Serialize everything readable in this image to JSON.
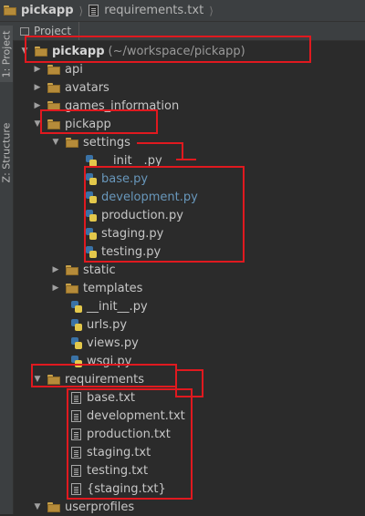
{
  "breadcrumb": {
    "root": "pickapp",
    "file": "requirements.txt"
  },
  "sidebar": {
    "project_tab": "1: Project",
    "structure_tab": "Z: Structure"
  },
  "panel": {
    "tab_label": "Project"
  },
  "tree": {
    "root": {
      "name": "pickapp",
      "path": "(~/workspace/pickapp)"
    },
    "items": [
      {
        "name": "api"
      },
      {
        "name": "avatars"
      },
      {
        "name": "games_information"
      },
      {
        "name": "pickapp"
      },
      {
        "name": "settings"
      },
      {
        "name": "__init__.py"
      },
      {
        "name": "base.py"
      },
      {
        "name": "development.py"
      },
      {
        "name": "production.py"
      },
      {
        "name": "staging.py"
      },
      {
        "name": "testing.py"
      },
      {
        "name": "static"
      },
      {
        "name": "templates"
      },
      {
        "name": "__init__.py"
      },
      {
        "name": "urls.py"
      },
      {
        "name": "views.py"
      },
      {
        "name": "wsgi.py"
      },
      {
        "name": "requirements"
      },
      {
        "name": "base.txt"
      },
      {
        "name": "development.txt"
      },
      {
        "name": "production.txt"
      },
      {
        "name": "staging.txt"
      },
      {
        "name": "testing.txt"
      },
      {
        "name": "{staging.txt}"
      },
      {
        "name": "userprofiles"
      }
    ]
  }
}
